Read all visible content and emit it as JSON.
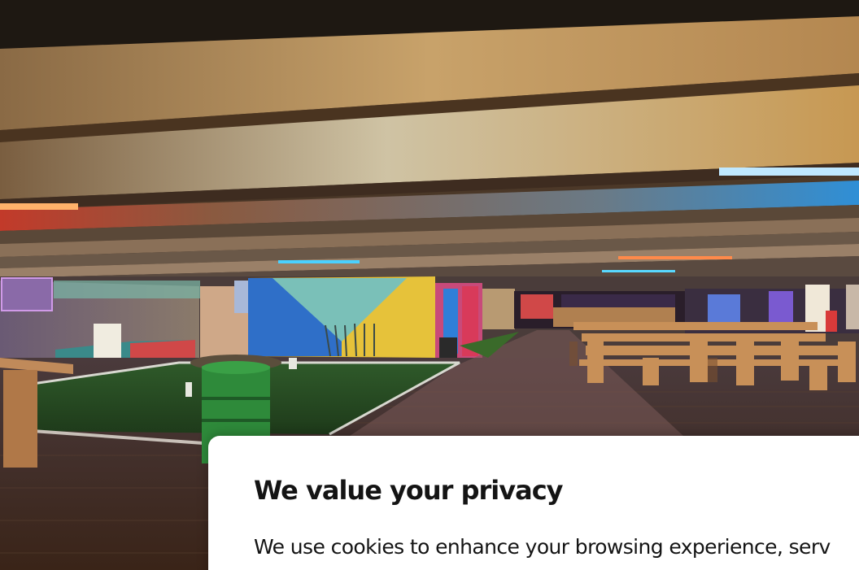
{
  "hero": {
    "image_description": "venue-interior-photo"
  },
  "privacy": {
    "title": "We value your privacy",
    "body": "We use cookies to enhance your browsing experience, serv"
  },
  "colors": {
    "modal_bg": "#ffffff",
    "text": "#141414"
  }
}
